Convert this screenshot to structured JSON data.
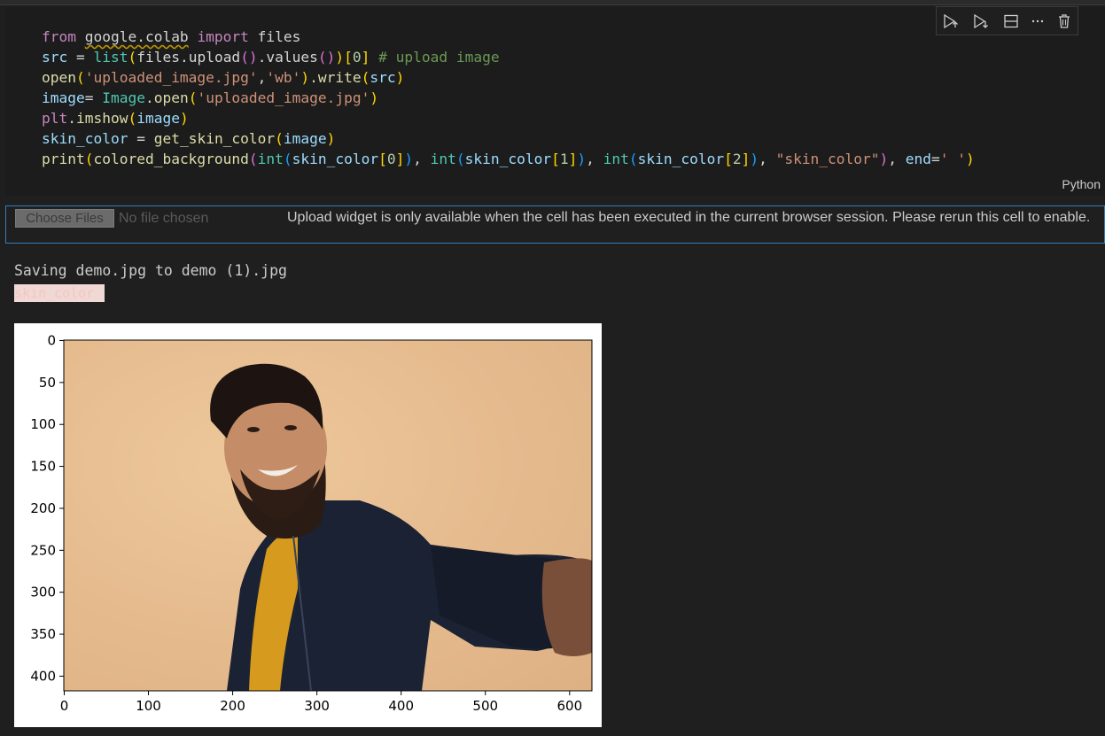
{
  "code_cell": {
    "language_label": "Python"
  },
  "toolbar": {
    "items": [
      {
        "icon": "run-above-icon"
      },
      {
        "icon": "run-below-icon"
      },
      {
        "icon": "split-cell-icon"
      },
      {
        "icon": "more-icon",
        "label": "···"
      },
      {
        "icon": "delete-icon"
      }
    ]
  },
  "upload_widget": {
    "button_label": "Choose Files",
    "file_status": "No file chosen",
    "message": "Upload widget is only available when the cell has been executed in the current browser session. Please rerun this cell to enable."
  },
  "output": {
    "saving_text": "Saving demo.jpg to demo (1).jpg",
    "skin_label": "skin_color",
    "skin_color_hex": "#f0d8d4"
  },
  "plot": {
    "image_alt": "man smiling taking a selfie",
    "x_ticks": [
      "0",
      "100",
      "200",
      "300",
      "400",
      "500",
      "600"
    ],
    "y_ticks": [
      "0",
      "50",
      "100",
      "150",
      "200",
      "250",
      "300",
      "350",
      "400"
    ]
  }
}
